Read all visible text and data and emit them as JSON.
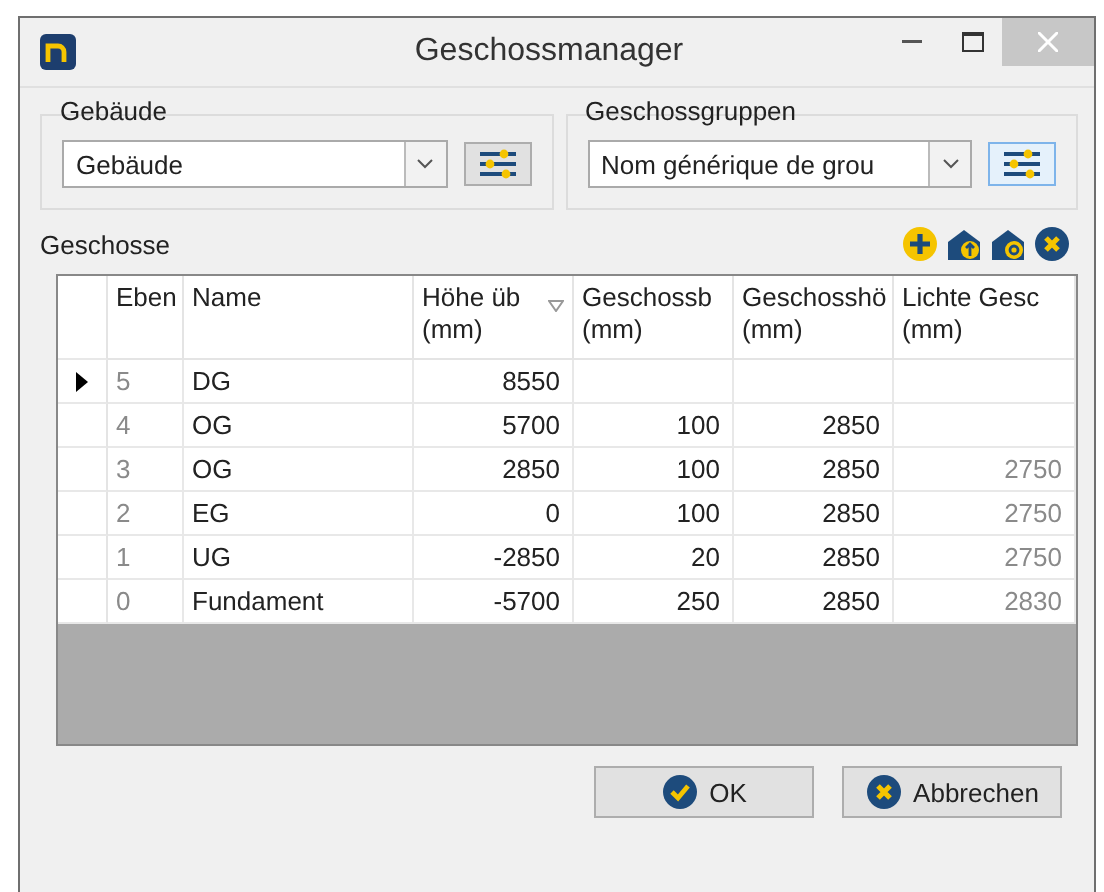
{
  "window": {
    "title": "Geschossmanager"
  },
  "groups": [
    {
      "label": "Gebäude",
      "value": "Gebäude",
      "highlighted": false
    },
    {
      "label": "Geschossgruppen",
      "value": "Nom générique de grou",
      "highlighted": true
    }
  ],
  "section": {
    "title": "Geschosse"
  },
  "table": {
    "columns": [
      {
        "label": "Eben",
        "muted": true,
        "sorted": false
      },
      {
        "label": "Name",
        "muted": false,
        "sorted": false
      },
      {
        "label": "Höhe üb",
        "unit": "(mm)",
        "muted": false,
        "sorted": true
      },
      {
        "label": "Geschossb",
        "unit": "(mm)",
        "muted": false,
        "sorted": false
      },
      {
        "label": "Geschosshö",
        "unit": "(mm)",
        "muted": false,
        "sorted": false
      },
      {
        "label": "Lichte Gesc",
        "unit": "(mm)",
        "muted": true,
        "sorted": false
      }
    ],
    "rows": [
      {
        "current": true,
        "cells": [
          "5",
          "DG",
          "8550",
          "",
          "",
          ""
        ]
      },
      {
        "current": false,
        "cells": [
          "4",
          "OG",
          "5700",
          "100",
          "2850",
          ""
        ]
      },
      {
        "current": false,
        "cells": [
          "3",
          "OG",
          "2850",
          "100",
          "2850",
          "2750"
        ]
      },
      {
        "current": false,
        "cells": [
          "2",
          "EG",
          "0",
          "100",
          "2850",
          "2750"
        ]
      },
      {
        "current": false,
        "cells": [
          "1",
          "UG",
          "-2850",
          "20",
          "2850",
          "2750"
        ]
      },
      {
        "current": false,
        "cells": [
          "0",
          "Fundament",
          "-5700",
          "250",
          "2850",
          "2830"
        ]
      }
    ]
  },
  "buttons": [
    {
      "label": "OK",
      "kind": "ok"
    },
    {
      "label": "Abbrechen",
      "kind": "cancel"
    }
  ]
}
